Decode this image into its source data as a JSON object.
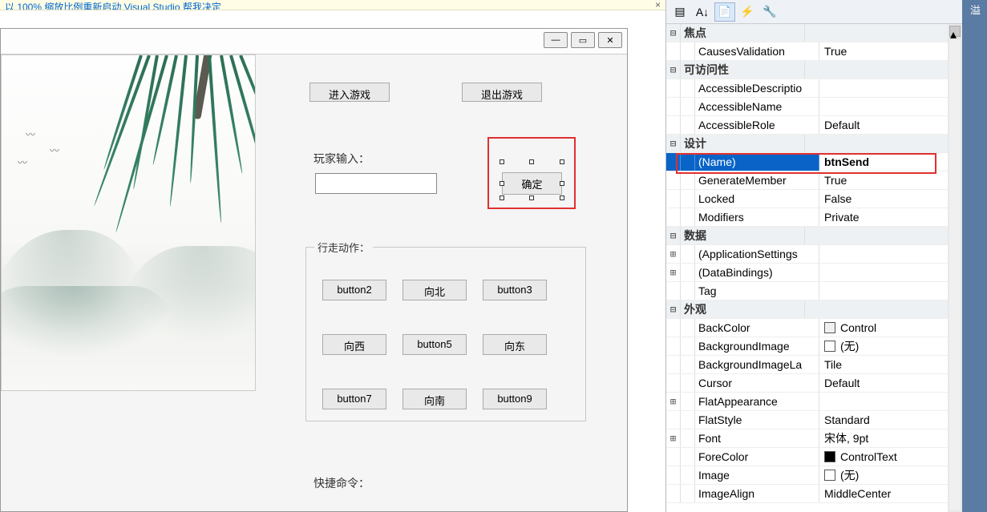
{
  "info_bar": {
    "text": "以 100% 缩放比例重新启动 Visual Studio    帮我决定"
  },
  "form": {
    "enter_btn": "进入游戏",
    "exit_btn": "退出游戏",
    "input_label": "玩家输入：",
    "ok_btn": "确定",
    "walk_legend": "行走动作：",
    "walk": {
      "b2": "button2",
      "north": "向北",
      "b3": "button3",
      "west": "向西",
      "b5": "button5",
      "east": "向东",
      "b7": "button7",
      "south": "向南",
      "b9": "button9"
    },
    "cmd_label": "快捷命令："
  },
  "props": {
    "cats": {
      "focus": "焦点",
      "access": "可访问性",
      "design": "设计",
      "data": "数据",
      "appearance": "外观"
    },
    "rows": {
      "causesValidation": {
        "n": "CausesValidation",
        "v": "True"
      },
      "accDesc": {
        "n": "AccessibleDescriptio",
        "v": ""
      },
      "accName": {
        "n": "AccessibleName",
        "v": ""
      },
      "accRole": {
        "n": "AccessibleRole",
        "v": "Default"
      },
      "name": {
        "n": "(Name)",
        "v": "btnSend"
      },
      "genMember": {
        "n": "GenerateMember",
        "v": "True"
      },
      "locked": {
        "n": "Locked",
        "v": "False"
      },
      "modifiers": {
        "n": "Modifiers",
        "v": "Private"
      },
      "appSet": {
        "n": "(ApplicationSettings",
        "v": ""
      },
      "dataBind": {
        "n": "(DataBindings)",
        "v": ""
      },
      "tag": {
        "n": "Tag",
        "v": ""
      },
      "backColor": {
        "n": "BackColor",
        "v": "Control"
      },
      "bgImage": {
        "n": "BackgroundImage",
        "v": "(无)"
      },
      "bgLayout": {
        "n": "BackgroundImageLa",
        "v": "Tile"
      },
      "cursor": {
        "n": "Cursor",
        "v": "Default"
      },
      "flatApp": {
        "n": "FlatAppearance",
        "v": ""
      },
      "flatStyle": {
        "n": "FlatStyle",
        "v": "Standard"
      },
      "font": {
        "n": "Font",
        "v": "宋体, 9pt"
      },
      "foreColor": {
        "n": "ForeColor",
        "v": "ControlText"
      },
      "image": {
        "n": "Image",
        "v": "(无)"
      },
      "imgAlign": {
        "n": "ImageAlign",
        "v": "MiddleCenter"
      }
    }
  },
  "edge_label": "溢"
}
